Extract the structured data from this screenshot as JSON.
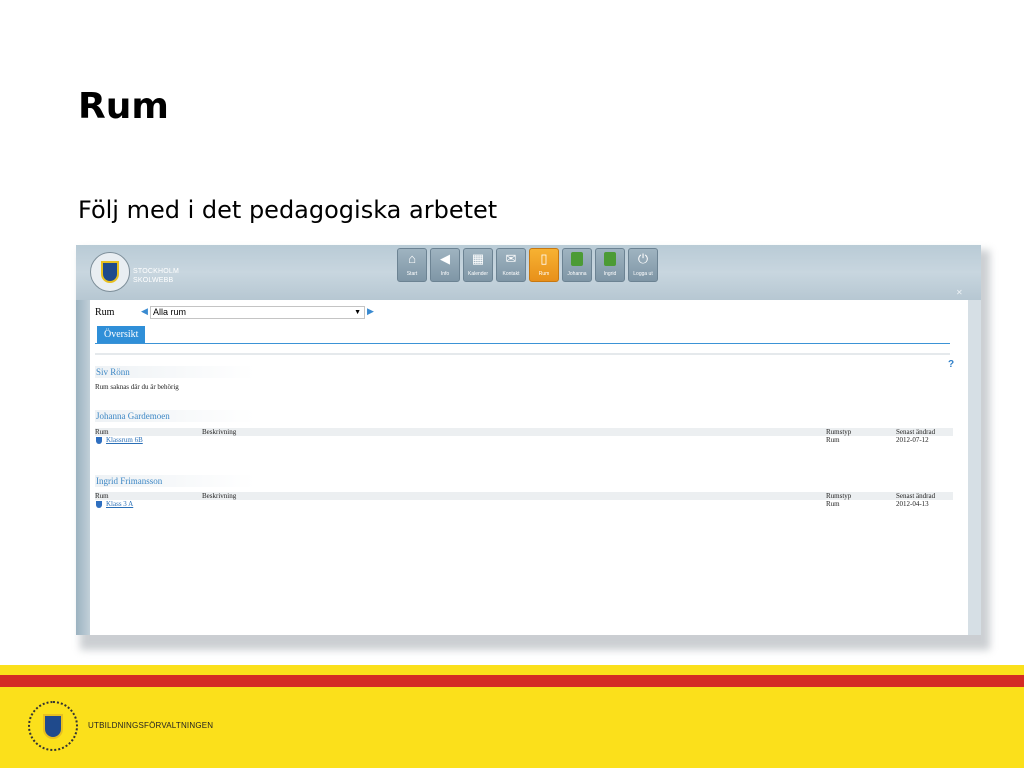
{
  "slide": {
    "title": "Rum",
    "subtitle": "Följ med i det pedagogiska arbetet"
  },
  "app": {
    "logo_line1": "STOCKHOLM",
    "logo_line2": "SKOLWEBB",
    "nav": [
      {
        "label": "Start",
        "icon": "home-icon",
        "active": false
      },
      {
        "label": "Info",
        "icon": "megaphone-icon",
        "active": false
      },
      {
        "label": "Kalender",
        "icon": "calendar-icon",
        "active": false
      },
      {
        "label": "Kontakt",
        "icon": "envelope-icon",
        "active": false
      },
      {
        "label": "Rum",
        "icon": "room-icon",
        "active": true
      },
      {
        "label": "Johanna",
        "icon": "user-add-icon",
        "active": false
      },
      {
        "label": "Ingrid",
        "icon": "user-add-icon",
        "active": false
      },
      {
        "label": "Logga ut",
        "icon": "power-icon",
        "active": false
      }
    ],
    "room_label": "Rum",
    "room_select": "Alla rum",
    "tab": "Översikt",
    "help": "?",
    "sections": [
      {
        "person": "Siv Rönn",
        "note": "Rum saknas där du är behörig"
      },
      {
        "person": "Johanna Gardemoen",
        "headers": {
          "rum": "Rum",
          "besk": "Beskrivning",
          "typ": "Rumstyp",
          "date": "Senast ändrad"
        },
        "row": {
          "rum": "Klassrum 6B",
          "besk": "",
          "typ": "Rum",
          "date": "2012-07-12"
        }
      },
      {
        "person": "Ingrid Frimansson",
        "headers": {
          "rum": "Rum",
          "besk": "Beskrivning",
          "typ": "Rumstyp",
          "date": "Senast ändrad"
        },
        "row": {
          "rum": "Klass 3 A",
          "besk": "",
          "typ": "Rum",
          "date": "2012-04-13"
        }
      }
    ]
  },
  "footer": {
    "org": "UTBILDNINGSFÖRVALTNINGEN"
  },
  "colors": {
    "accent_blue": "#2f8fd8",
    "active_orange": "#f0a020",
    "footer_yellow": "#fbe01b",
    "footer_red": "#d42b25"
  }
}
